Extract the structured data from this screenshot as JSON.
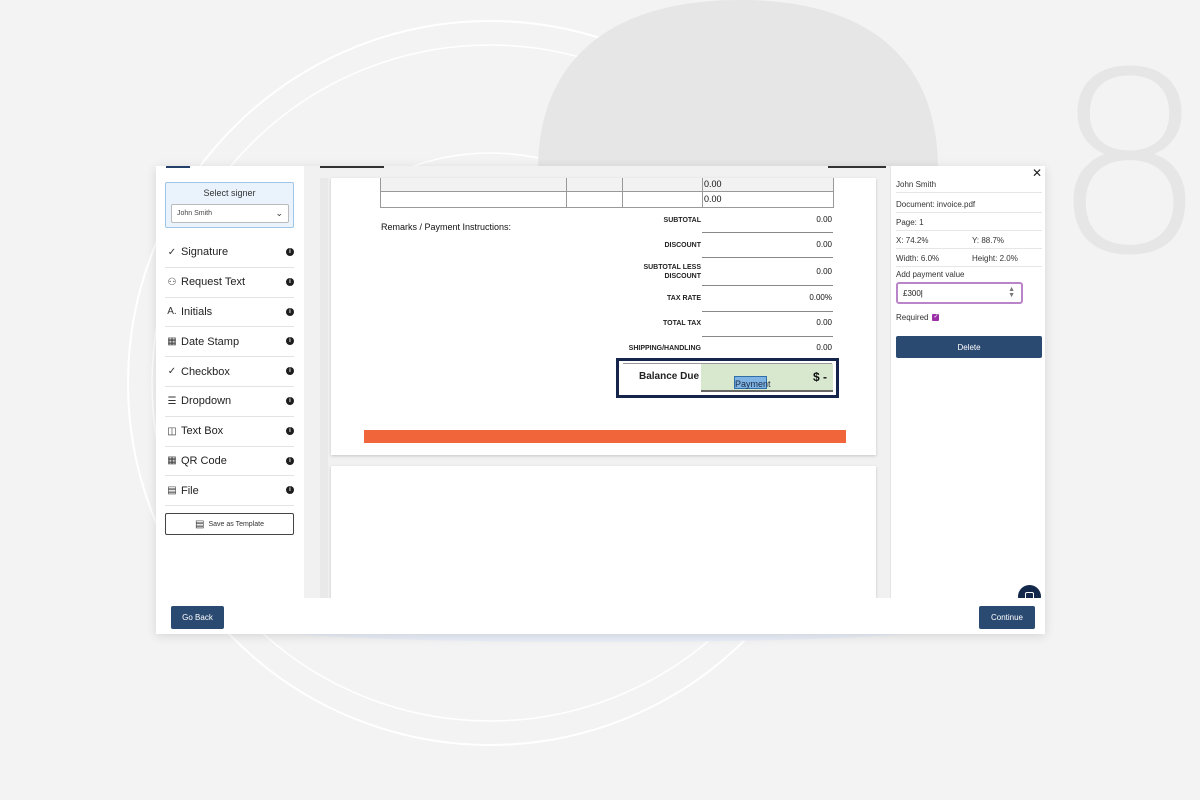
{
  "background": {
    "decor_number": "8"
  },
  "sidebar": {
    "signer_title": "Select signer",
    "signer_value": "John Smith",
    "tools": [
      {
        "label": "Signature",
        "icon": "signature-icon"
      },
      {
        "label": "Request Text",
        "icon": "request-text-icon"
      },
      {
        "label": "Initials",
        "icon": "initials-icon"
      },
      {
        "label": "Date Stamp",
        "icon": "calendar-icon"
      },
      {
        "label": "Checkbox",
        "icon": "checkbox-icon"
      },
      {
        "label": "Dropdown",
        "icon": "dropdown-icon"
      },
      {
        "label": "Text Box",
        "icon": "text-box-icon"
      },
      {
        "label": "QR Code",
        "icon": "qr-code-icon"
      },
      {
        "label": "File",
        "icon": "file-icon"
      }
    ],
    "save_template": "Save as Template"
  },
  "document": {
    "table_values": [
      "0.00",
      "0.00"
    ],
    "remarks": "Remarks / Payment Instructions:",
    "totals": [
      {
        "label": "SUBTOTAL",
        "value": "0.00"
      },
      {
        "label": "DISCOUNT",
        "value": "0.00"
      },
      {
        "label": "SUBTOTAL LESS DISCOUNT",
        "value": "0.00"
      },
      {
        "label": "TAX RATE",
        "value": "0.00%"
      },
      {
        "label": "TOTAL TAX",
        "value": "0.00"
      },
      {
        "label": "SHIPPING/HANDLING",
        "value": "0.00"
      }
    ],
    "balance_label": "Balance Due",
    "balance_value": "$ -",
    "payment_field_label": "Payment",
    "accent_color": "#f0653a"
  },
  "panel": {
    "signer": "John Smith",
    "document": "Document: invoice.pdf",
    "page": "Page: 1",
    "x": "X: 74.2%",
    "y": "Y: 88.7%",
    "width": "Width: 6.0%",
    "height": "Height: 2.0%",
    "add_payment_label": "Add payment value",
    "payment_value": "£300",
    "required_label": "Required",
    "required_checked": true,
    "delete_label": "Delete"
  },
  "footer": {
    "back_label": "Go Back",
    "continue_label": "Continue"
  },
  "colors": {
    "primary": "#2b4a72",
    "navy": "#13294b",
    "highlight": "#d7e8cf",
    "selection": "#7eb3e3",
    "checkbox": "#9a2fa8"
  }
}
